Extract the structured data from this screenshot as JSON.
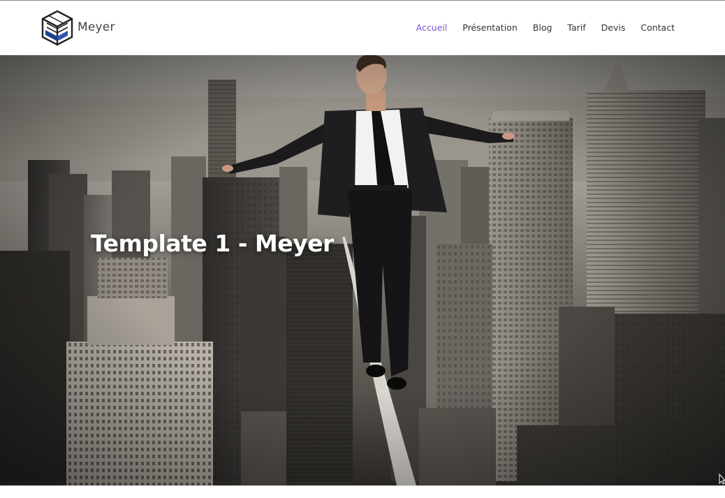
{
  "brand": {
    "name": "Meyer",
    "logo_icon": "cube-logo-icon"
  },
  "nav": {
    "items": [
      {
        "label": "Accueil",
        "active": true
      },
      {
        "label": "Présentation",
        "active": false
      },
      {
        "label": "Blog",
        "active": false
      },
      {
        "label": "Tarif",
        "active": false
      },
      {
        "label": "Devis",
        "active": false
      },
      {
        "label": "Contact",
        "active": false
      }
    ]
  },
  "hero": {
    "title": "Template 1 - Meyer",
    "image": "businessman-walking-tightrope-over-city"
  },
  "colors": {
    "accent": "#7b4fd8",
    "text": "#333333",
    "brand_text": "#444444",
    "logo_blue": "#1e3f8f"
  }
}
